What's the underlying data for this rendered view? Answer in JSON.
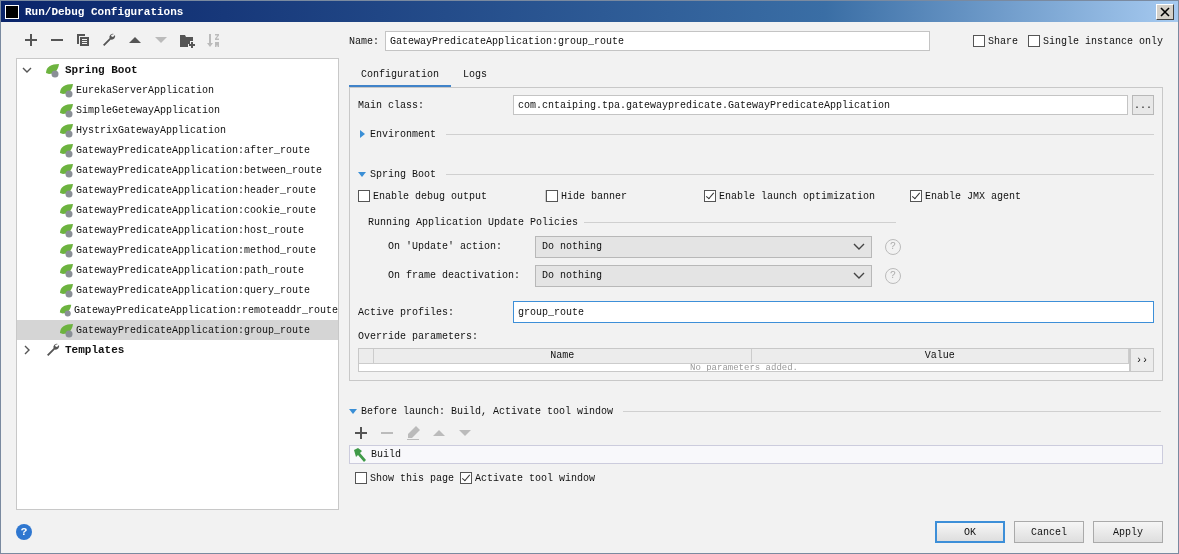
{
  "window": {
    "title": "Run/Debug Configurations"
  },
  "toolbar": [
    {
      "kind": "add",
      "disabled": false
    },
    {
      "kind": "remove",
      "disabled": false
    },
    {
      "kind": "copy",
      "disabled": false
    },
    {
      "kind": "wrench",
      "disabled": false
    },
    {
      "kind": "up",
      "disabled": false
    },
    {
      "kind": "down",
      "disabled": true
    },
    {
      "kind": "folder",
      "disabled": false
    },
    {
      "kind": "sort",
      "disabled": true
    }
  ],
  "tree": [
    {
      "label": "Spring Boot",
      "kind": "spring",
      "expanded": true,
      "children": [
        {
          "label": "EurekaServerApplication",
          "selected": false
        },
        {
          "label": "SimpleGetewayApplication",
          "selected": false
        },
        {
          "label": "HystrixGatewayApplication",
          "selected": false
        },
        {
          "label": "GatewayPredicateApplication:after_route",
          "selected": false
        },
        {
          "label": "GatewayPredicateApplication:between_route",
          "selected": false
        },
        {
          "label": "GatewayPredicateApplication:header_route",
          "selected": false
        },
        {
          "label": "GatewayPredicateApplication:cookie_route",
          "selected": false
        },
        {
          "label": "GatewayPredicateApplication:host_route",
          "selected": false
        },
        {
          "label": "GatewayPredicateApplication:method_route",
          "selected": false
        },
        {
          "label": "GatewayPredicateApplication:path_route",
          "selected": false
        },
        {
          "label": "GatewayPredicateApplication:query_route",
          "selected": false
        },
        {
          "label": "GatewayPredicateApplication:remoteaddr_route",
          "selected": false
        },
        {
          "label": "GatewayPredicateApplication:group_route",
          "selected": true
        }
      ]
    },
    {
      "label": "Templates",
      "kind": "wrench",
      "expanded": false
    }
  ],
  "name": {
    "label": "Name:",
    "value": "GatewayPredicateApplication:group_route"
  },
  "options": [
    {
      "label": "Share",
      "checked": false
    },
    {
      "label": "Single instance only",
      "checked": false
    }
  ],
  "tabs": [
    {
      "label": "Configuration",
      "selected": true
    },
    {
      "label": "Logs",
      "selected": false
    }
  ],
  "main_class": {
    "label": "Main class:",
    "value": "com.cntaiping.tpa.gatewaypredicate.GatewayPredicateApplication",
    "button": "..."
  },
  "environment": {
    "label": "Environment",
    "expanded": false
  },
  "spring_boot": {
    "label": "Spring Boot",
    "expanded": true,
    "checkboxes": [
      {
        "label": "Enable debug output",
        "checked": false
      },
      {
        "label": "Hide banner",
        "checked": false
      },
      {
        "label": "Enable launch optimization",
        "checked": true
      },
      {
        "label": "Enable JMX agent",
        "checked": true
      }
    ],
    "policies_title": "Running Application Update Policies",
    "policies": [
      {
        "label": "On 'Update' action:",
        "value": "Do nothing",
        "help": "?"
      },
      {
        "label": "On frame deactivation:",
        "value": "Do nothing",
        "help": "?"
      }
    ]
  },
  "active_profiles": {
    "label": "Active profiles:",
    "value": "group_route"
  },
  "override_parameters": {
    "label": "Override parameters:",
    "columns": [
      "Name",
      "Value"
    ],
    "empty_text": "No parameters added.",
    "button": "››"
  },
  "before_launch": {
    "label": "Before launch: Build, Activate tool window",
    "expanded": true,
    "toolbar": [
      {
        "kind": "add",
        "disabled": false
      },
      {
        "kind": "remove",
        "disabled": true
      },
      {
        "kind": "edit",
        "disabled": true
      },
      {
        "kind": "up",
        "disabled": true
      },
      {
        "kind": "down",
        "disabled": true
      }
    ],
    "tasks": [
      {
        "label": "Build"
      }
    ],
    "checkboxes": [
      {
        "label": "Show this page",
        "checked": false
      },
      {
        "label": "Activate tool window",
        "checked": true
      }
    ]
  },
  "help_button": "?",
  "buttons": [
    {
      "label": "OK",
      "default": true
    },
    {
      "label": "Cancel",
      "default": false
    },
    {
      "label": "Apply",
      "default": false
    }
  ]
}
